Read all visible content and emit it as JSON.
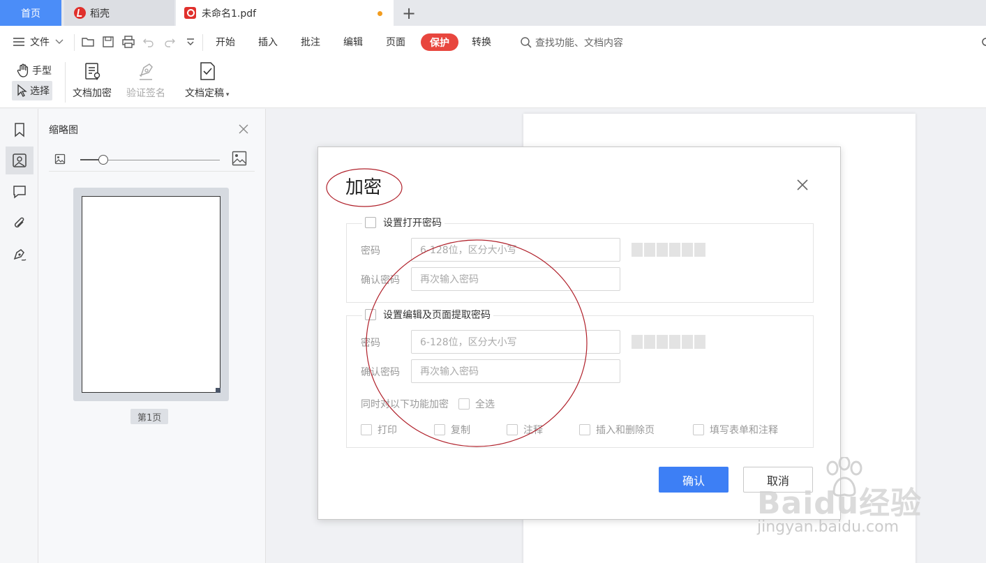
{
  "tabs": {
    "home": "首页",
    "docer": "稻壳",
    "document": "未命名1.pdf"
  },
  "menu": {
    "file": "文件",
    "items": [
      "开始",
      "插入",
      "批注",
      "编辑",
      "页面",
      "保护",
      "转换"
    ],
    "active": "保护",
    "search_placeholder": "查找功能、文档内容"
  },
  "ribbon": {
    "hand": "手型",
    "select": "选择",
    "encrypt": "文档加密",
    "verify_sign": "验证签名",
    "finalize": "文档定稿"
  },
  "thumbnails": {
    "title": "缩略图",
    "page_label": "第1页"
  },
  "dialog": {
    "title": "加密",
    "open_pwd": {
      "checkbox_label": "设置打开密码",
      "pwd_label": "密码",
      "pwd_placeholder": "6-128位，区分大小写",
      "confirm_label": "确认密码",
      "confirm_placeholder": "再次输入密码"
    },
    "edit_pwd": {
      "checkbox_label": "设置编辑及页面提取密码",
      "pwd_label": "密码",
      "pwd_placeholder": "6-128位，区分大小写",
      "confirm_label": "确认密码",
      "confirm_placeholder": "再次输入密码",
      "also_encrypt_label": "同时对以下功能加密",
      "select_all": "全选",
      "options": [
        "打印",
        "复制",
        "注释",
        "插入和删除页",
        "填写表单和注释"
      ]
    },
    "ok": "确认",
    "cancel": "取消"
  },
  "watermark": {
    "brand": "Baidu经验",
    "url": "jingyan.baidu.com"
  },
  "colors": {
    "accent": "#3d7ff5",
    "protect_pill": "#e8463e",
    "home_tab": "#4b8df8",
    "annotation": "#b0202a"
  }
}
